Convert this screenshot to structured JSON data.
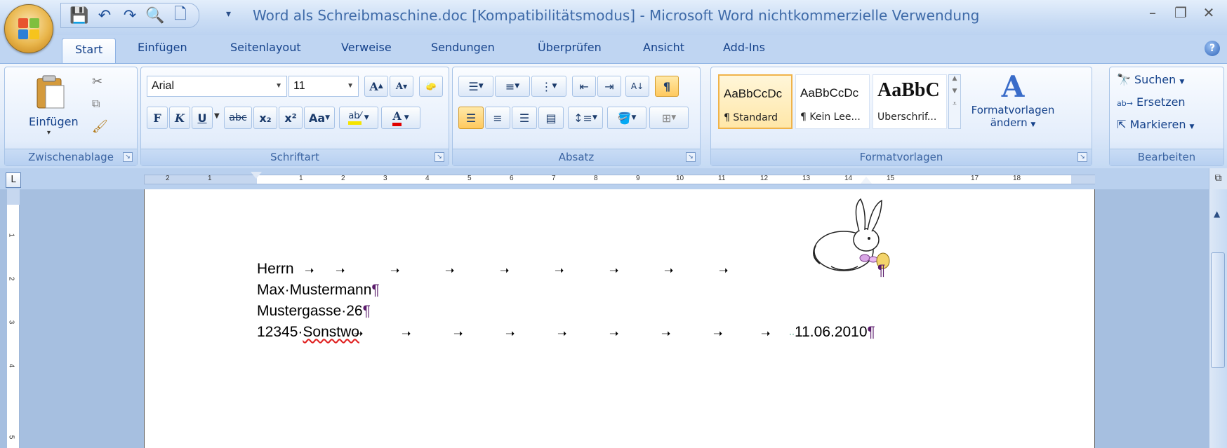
{
  "window": {
    "title": "Word als Schreibmaschine.doc [Kompatibilitätsmodus] - Microsoft Word nichtkommerzielle Verwendung"
  },
  "tabs": [
    {
      "label": "Start",
      "active": true
    },
    {
      "label": "Einfügen"
    },
    {
      "label": "Seitenlayout"
    },
    {
      "label": "Verweise"
    },
    {
      "label": "Sendungen"
    },
    {
      "label": "Überprüfen"
    },
    {
      "label": "Ansicht"
    },
    {
      "label": "Add-Ins"
    }
  ],
  "ribbon": {
    "clipboard": {
      "label": "Zwischenablage",
      "paste": "Einfügen"
    },
    "font": {
      "label": "Schriftart",
      "font_name": "Arial",
      "font_size": "11",
      "bold": "F",
      "italic": "K",
      "underline": "U",
      "strike": "abc",
      "subscript": "x₂",
      "superscript": "x²",
      "change_case": "Aa"
    },
    "paragraph": {
      "label": "Absatz"
    },
    "styles": {
      "label": "Formatvorlagen",
      "items": [
        {
          "preview": "AaBbCcDc",
          "name": "¶ Standard"
        },
        {
          "preview": "AaBbCcDc",
          "name": "¶ Kein Lee..."
        },
        {
          "preview": "AaBbC",
          "name": "Überschrif..."
        }
      ],
      "change_styles_1": "Formatvorlagen",
      "change_styles_2": "ändern"
    },
    "editing": {
      "label": "Bearbeiten",
      "find": "Suchen",
      "replace": "Ersetzen",
      "select": "Markieren"
    }
  },
  "ruler": {
    "ticks": [
      "2",
      "1",
      "1",
      "2",
      "3",
      "4",
      "5",
      "6",
      "7",
      "8",
      "9",
      "10",
      "11",
      "12",
      "13",
      "14",
      "15",
      "17",
      "18"
    ],
    "vticks": [
      "1",
      "2",
      "3",
      "4",
      "5"
    ]
  },
  "document": {
    "line1": "Herrn",
    "line2": "Max·Mustermann",
    "line3": "Mustergasse·26",
    "line4_left": "12345·",
    "line4_city": "Sonstwo",
    "date": "11.06.2010",
    "pilcrow": "¶",
    "dots": "··········"
  }
}
